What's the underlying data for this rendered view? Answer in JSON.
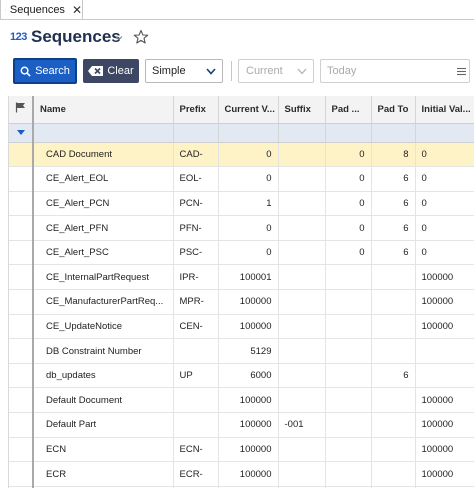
{
  "tab": {
    "label": "Sequences",
    "close": "✕"
  },
  "header": {
    "icon_text": "123",
    "title": "Sequences"
  },
  "toolbar": {
    "search_label": "Search",
    "clear_label": "Clear",
    "mode_value": "Simple",
    "current_value": "Current",
    "today_placeholder": "Today"
  },
  "grid": {
    "columns": [
      "Name",
      "Prefix",
      "Current V...",
      "Suffix",
      "Pad ...",
      "Pad To",
      "Initial Val..."
    ],
    "rows": [
      [
        "CAD Document",
        "CAD-",
        "0",
        "",
        "0",
        "8",
        "0"
      ],
      [
        "CE_Alert_EOL",
        "EOL-",
        "0",
        "",
        "0",
        "6",
        "0"
      ],
      [
        "CE_Alert_PCN",
        "PCN-",
        "1",
        "",
        "0",
        "6",
        "0"
      ],
      [
        "CE_Alert_PFN",
        "PFN-",
        "0",
        "",
        "0",
        "6",
        "0"
      ],
      [
        "CE_Alert_PSC",
        "PSC-",
        "0",
        "",
        "0",
        "6",
        "0"
      ],
      [
        "CE_InternalPartRequest",
        "IPR-",
        "100001",
        "",
        "",
        "",
        "100000"
      ],
      [
        "CE_ManufacturerPartReq...",
        "MPR-",
        "100000",
        "",
        "",
        "",
        "100000"
      ],
      [
        "CE_UpdateNotice",
        "CEN-",
        "100000",
        "",
        "",
        "",
        "100000"
      ],
      [
        "DB Constraint Number",
        "",
        "5129",
        "",
        "",
        "",
        ""
      ],
      [
        "db_updates",
        "UP",
        "6000",
        "",
        "",
        "6",
        ""
      ],
      [
        "Default Document",
        "",
        "100000",
        "",
        "",
        "",
        "100000"
      ],
      [
        "Default Part",
        "",
        "100000",
        "-001",
        "",
        "",
        "100000"
      ],
      [
        "ECN",
        "ECN-",
        "100000",
        "",
        "",
        "",
        "100000"
      ],
      [
        "ECR",
        "ECR-",
        "100000",
        "",
        "",
        "",
        "100000"
      ],
      [
        "",
        "",
        "",
        "",
        "",
        "",
        ""
      ]
    ],
    "selected_row": 0
  },
  "colors": {
    "accent": "#1b5fc4",
    "clear_button": "#3d4663",
    "selected_row": "#fdf3c6",
    "filter_row": "#e3e9f3"
  },
  "icons": [
    "search-icon",
    "close-icon",
    "chevron-down-icon",
    "star-icon",
    "clear-icon",
    "flag-icon",
    "funnel-icon",
    "menu-icon"
  ]
}
